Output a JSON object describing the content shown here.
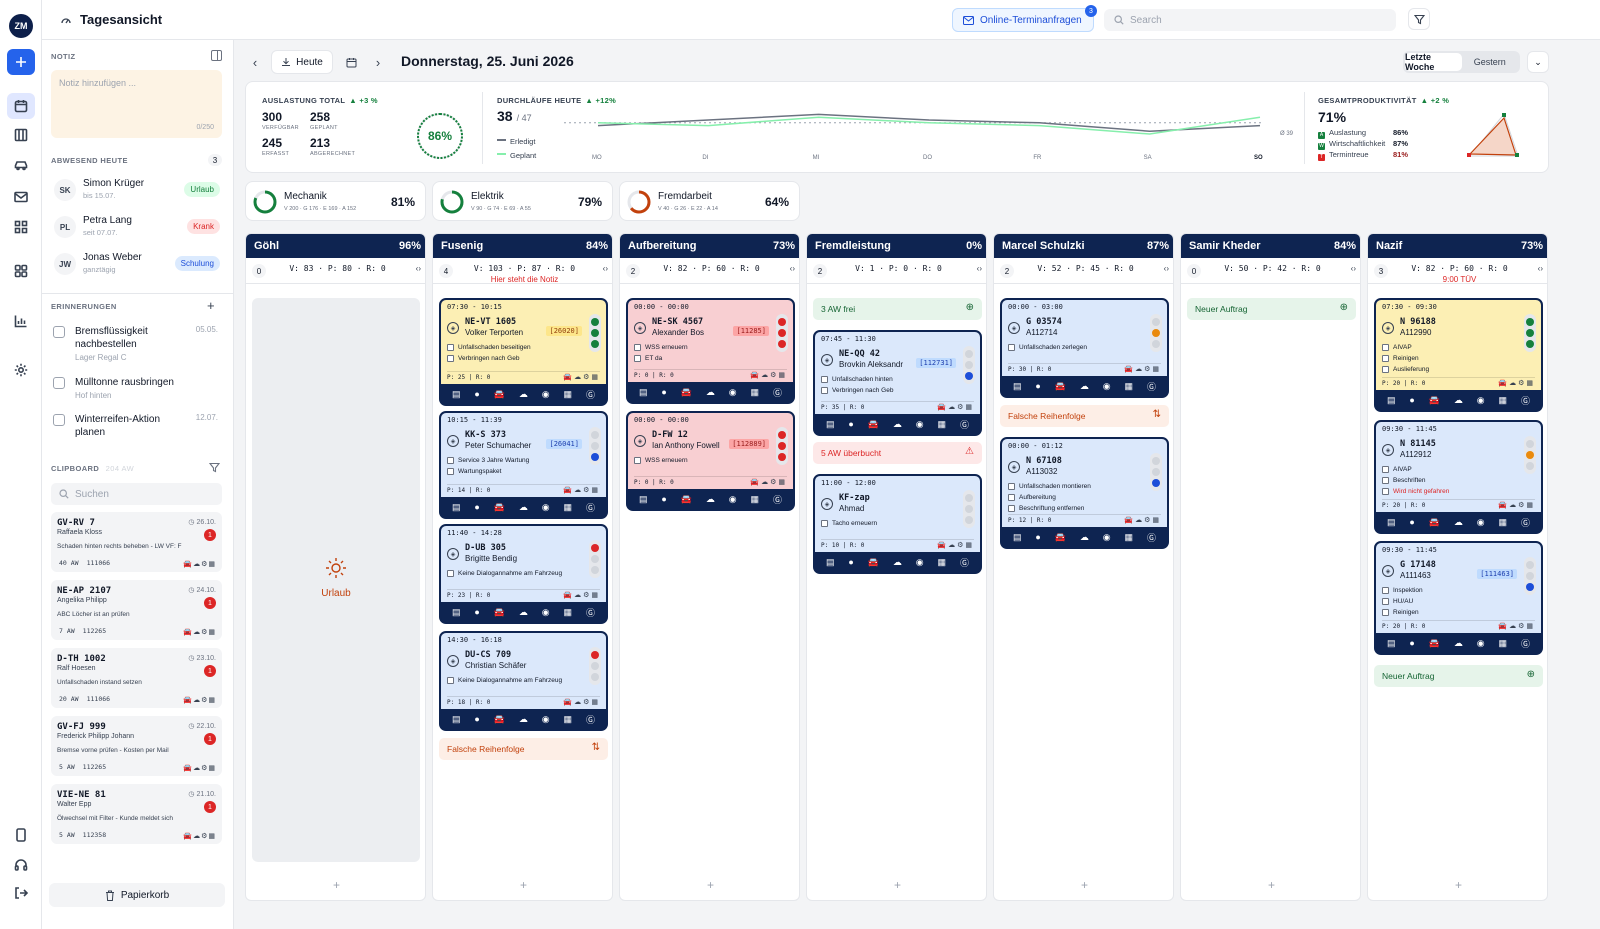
{
  "topbar": {
    "title": "Tagesansicht",
    "online_label": "Online-Terminanfragen",
    "online_count": "3",
    "search_placeholder": "Search"
  },
  "rail": {
    "logo": "ZM"
  },
  "sidebar": {
    "note_header": "NOTIZ",
    "note_placeholder": "Notiz hinzufügen ...",
    "note_count": "0/250",
    "absent_header": "ABWESEND HEUTE",
    "absent_count": "3",
    "absent": [
      {
        "initials": "SK",
        "name": "Simon Krüger",
        "sub": "bis 15.07.",
        "tag": "Urlaub",
        "tag_color": "#15803d",
        "tag_bg": "#dcfce7"
      },
      {
        "initials": "PL",
        "name": "Petra Lang",
        "sub": "seit 07.07.",
        "tag": "Krank",
        "tag_color": "#dc2626",
        "tag_bg": "#fee2e2"
      },
      {
        "initials": "JW",
        "name": "Jonas Weber",
        "sub": "ganztägig",
        "tag": "Schulung",
        "tag_color": "#1d4ed8",
        "tag_bg": "#dbeafe"
      }
    ],
    "reminders_header": "ERINNERUNGEN",
    "reminders": [
      {
        "text": "Bremsflüssigkeit nachbestellen",
        "sub": "Lager Regal C",
        "date": "05.05."
      },
      {
        "text": "Mülltonne rausbringen",
        "sub": "Hof hinten",
        "date": ""
      },
      {
        "text": "Winterreifen-Aktion planen",
        "sub": "",
        "date": "12.07."
      }
    ],
    "clipboard_header": "CLIPBOARD",
    "clipboard_aw": "204 AW",
    "clip_search": "Suchen",
    "clips": [
      {
        "plate": "GV-RV 7",
        "driver": "Raffaela Kloss",
        "desc": "Schaden hinten rechts beheben - LW VF: F",
        "date": "26.10.",
        "badge": "1",
        "aw": "40 AW",
        "num": "111066"
      },
      {
        "plate": "NE-AP 2107",
        "driver": "Angelika Philipp",
        "desc": "ABC Löcher ist an prüfen",
        "date": "24.10.",
        "badge": "1",
        "aw": "7 AW",
        "num": "112265"
      },
      {
        "plate": "D-TH 1002",
        "driver": "Ralf Hoesen",
        "desc": "Unfallschaden instand setzen",
        "date": "23.10.",
        "badge": "1",
        "aw": "20 AW",
        "num": "111066"
      },
      {
        "plate": "GV-FJ 999",
        "driver": "Frederick Philipp Johann",
        "desc": "Bremse vorne prüfen - Kosten per Mail",
        "date": "22.10.",
        "badge": "1",
        "aw": "5 AW",
        "num": "112265"
      },
      {
        "plate": "VIE-NE 81",
        "driver": "Walter Epp",
        "desc": "Ölwechsel mit Filter - Kunde meldet sich",
        "date": "21.10.",
        "badge": "1",
        "aw": "5 AW",
        "num": "112358"
      }
    ],
    "trash_label": "Papierkorb"
  },
  "datebar": {
    "today": "Heute",
    "date": "Donnerstag, 25. Juni 2026",
    "period_a": "Letzte Woche",
    "period_b": "Gestern"
  },
  "kpi": {
    "auslastung": {
      "title": "AUSLASTUNG TOTAL",
      "delta": "▲ +3 %",
      "verfuegbar": "300",
      "geplant": "258",
      "erfasst": "245",
      "abgerechnet": "213",
      "l1": "VERFÜGBAR",
      "l2": "GEPLANT",
      "l3": "ERFASST",
      "l4": "ABGERECHNET",
      "pct": "86%",
      "pct_value": 0.86
    },
    "durchlaeufe": {
      "title": "DURCHLÄUFE HEUTE",
      "delta": "▲ +12%",
      "value": "38",
      "total": "/ 47",
      "leg1": "Erledigt",
      "leg2": "Geplant",
      "avg": "Ø 39",
      "days": [
        "MO",
        "DI",
        "MI",
        "DO",
        "FR",
        "SA",
        "SO"
      ]
    },
    "produktivitaet": {
      "title": "GESAMTPRODUKTIVITÄT",
      "delta": "▲ +2 %",
      "value": "71%",
      "rows": [
        {
          "k": "A",
          "name": "Auslastung",
          "v": "86%",
          "color": "#15803d"
        },
        {
          "k": "W",
          "name": "Wirtschaftlichkeit",
          "v": "87%",
          "color": "#15803d"
        },
        {
          "k": "T",
          "name": "Termintreue",
          "v": "81%",
          "color": "#dc2626"
        }
      ]
    }
  },
  "chart_data": {
    "type": "line",
    "x": [
      "MO",
      "DI",
      "MI",
      "DO",
      "FR",
      "SA",
      "SO"
    ],
    "series": [
      {
        "name": "Erledigt",
        "values": [
          38,
          40,
          42,
          40,
          39,
          36,
          38
        ]
      },
      {
        "name": "Geplant",
        "values": [
          39,
          38,
          41,
          39,
          38,
          35,
          41
        ]
      }
    ],
    "ylim": [
      0,
      47
    ]
  },
  "depts": [
    {
      "name": "Mechanik",
      "sub": "V 200 · G 176 · E 169 · A 152",
      "pct": "81%",
      "value": 0.81,
      "color": "#15803d"
    },
    {
      "name": "Elektrik",
      "sub": "V 90 · G 74 · E 69 · A 55",
      "pct": "79%",
      "value": 0.79,
      "color": "#15803d"
    },
    {
      "name": "Fremdarbeit",
      "sub": "V 40 · G 26 · E 22 · A 14",
      "pct": "64%",
      "value": 0.64,
      "color": "#c2410c"
    }
  ],
  "columns": [
    {
      "name": "Göhl",
      "pct": "96%",
      "count": "0",
      "stats": "V: 83 · P: 80 · R: 0",
      "note": "",
      "vacation": "Urlaub"
    },
    {
      "name": "Fusenig",
      "pct": "84%",
      "count": "4",
      "stats": "V: 103 · P: 87 · R: 0",
      "note": "Hier steht die Notiz"
    },
    {
      "name": "Aufbereitung",
      "pct": "73%",
      "count": "2",
      "stats": "V: 82 · P: 60 · R: 0",
      "note": ""
    },
    {
      "name": "Fremdleistung",
      "pct": "0%",
      "count": "2",
      "stats": "V: 1 · P: 0 · R: 0",
      "note": ""
    },
    {
      "name": "Marcel Schulzki",
      "pct": "87%",
      "count": "2",
      "stats": "V: 52 · P: 45 · R: 0",
      "note": ""
    },
    {
      "name": "Samir Kheder",
      "pct": "84%",
      "count": "0",
      "stats": "V: 50 · P: 42 · R: 0",
      "note": ""
    },
    {
      "name": "Nazif",
      "pct": "73%",
      "count": "3",
      "stats": "V: 82 · P: 60 · R: 0",
      "note": "9:00 TÜV"
    }
  ],
  "cards": {
    "c1a": {
      "time": "07:30 - 10:15",
      "plate": "NE-VT 1605",
      "customer": "Volker Terporten",
      "ref": "[26020]",
      "t1": "Unfallschaden beseitigen",
      "t2": "Verbringen nach Geb",
      "pr": "P: 25  |  R: 0"
    },
    "c1b": {
      "time": "10:15 - 11:39",
      "plate": "KK-S 373",
      "customer": "Peter Schumacher",
      "ref": "[26041]",
      "t1": "Service 3 Jahre Wartung",
      "t2": "Wartungspaket",
      "pr": "P: 14  |  R: 0"
    },
    "c1c": {
      "time": "11:40 - 14:28",
      "plate": "D-UB 305",
      "customer": "Brigitte Bendig",
      "t1": "Keine Dialogannahme am Fahrzeug",
      "pr": "P: 23  |  R: 0"
    },
    "c1d": {
      "time": "14:30 - 16:18",
      "plate": "DU-CS 709",
      "customer": "Christian Schäfer",
      "t1": "Keine Dialogannahme am Fahrzeug",
      "pr": "P: 18  |  R: 0"
    },
    "c2a": {
      "time": "00:00 - 00:00",
      "plate": "NE-SK 4567",
      "customer": "Alexander Bos",
      "ref": "[11285]",
      "t1": "WSS erneuern",
      "t2": "ET da",
      "pr": "P: 0  |  R: 0"
    },
    "c2b": {
      "time": "00:00 - 00:00",
      "plate": "D-FW 12",
      "customer": "Ian Anthony Fowell",
      "ref": "[112889]",
      "t1": "WSS erneuern",
      "pr": "P: 0  |  R: 0"
    },
    "c3a": {
      "time": "07:45 - 11:30",
      "plate": "NE-QQ 42",
      "customer": "Brovkin Aleksandr",
      "ref": "[112731]",
      "t1": "Unfallschaden hinten",
      "t2": "Verbringen nach Geb",
      "pr": "P: 35  |  R: 0"
    },
    "c3b": {
      "time": "11:00 - 12:00",
      "plate": "KF-zap",
      "customer": "Ahmad",
      "t1": "Tacho erneuern",
      "pr": "P: 10  |  R: 0"
    },
    "c4a": {
      "time": "00:00 - 03:00",
      "plate": "G 03574",
      "customer": "A112714",
      "t1": "Unfallschaden zerlegen",
      "pr": "P: 30  |  R: 0"
    },
    "c4b": {
      "time": "00:00 - 01:12",
      "plate": "N 67108",
      "customer": "A113032",
      "t1": "Unfallschaden montieren",
      "t2": "Aufbereitung",
      "t3": "Beschriftung entfernen",
      "pr": "P: 12  |  R: 0"
    },
    "c6a": {
      "time": "07:30 - 09:30",
      "plate": "N 96188",
      "customer": "A112990",
      "t1": "AIVAP",
      "t2": "Reinigen",
      "t3": "Auslieferung",
      "pr": "P: 20  |  R: 0"
    },
    "c6b": {
      "time": "09:30 - 11:45",
      "plate": "N 81145",
      "customer": "A112912",
      "t1": "AIVAP",
      "t2": "Beschriften",
      "t3": "Wird nicht gefahren",
      "pr": "P: 20  |  R: 0"
    },
    "c6c": {
      "time": "09:30 - 11:45",
      "plate": "G 17148",
      "customer": "A111463",
      "ref": "[111463]",
      "t1": "Inspektion",
      "t2": "HU/AU",
      "t3": "Reinigen",
      "pr": "P: 20  |  R: 0"
    }
  },
  "banners": {
    "falsche": "Falsche Reihenfolge",
    "aw_frei": "3 AW frei",
    "aw_ueber": "5 AW überbucht",
    "neuer_auftrag": "Neuer Auftrag"
  }
}
